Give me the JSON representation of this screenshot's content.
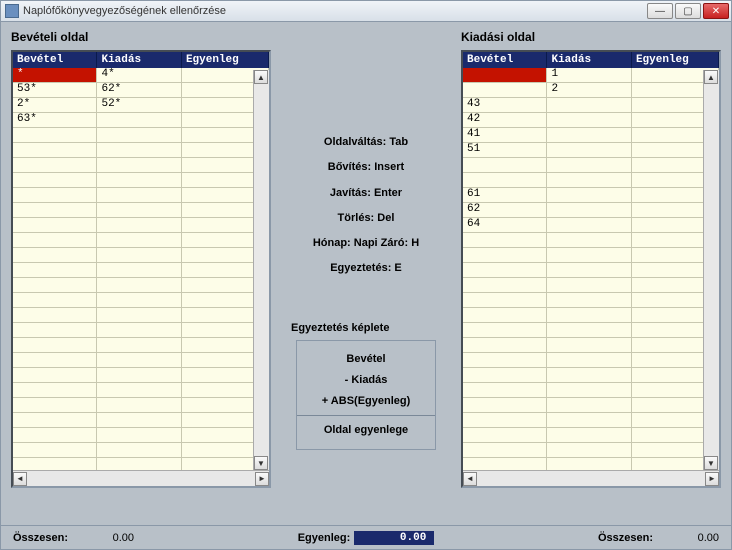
{
  "window": {
    "title": "Naplófőkönyvegyezőségének ellenőrzése"
  },
  "left": {
    "title": "Bevételi oldal",
    "headers": {
      "a": "Bevétel",
      "b": "Kiadás",
      "c": "Egyenleg"
    },
    "rows": [
      {
        "a": "*",
        "b": "4*",
        "c": "",
        "selected": true
      },
      {
        "a": "53*",
        "b": "62*",
        "c": ""
      },
      {
        "a": "2*",
        "b": "52*",
        "c": ""
      },
      {
        "a": "63*",
        "b": "",
        "c": ""
      }
    ],
    "sum_label": "Összesen:",
    "sum_value": "0.00"
  },
  "right": {
    "title": "Kiadási oldal",
    "headers": {
      "a": "Bevétel",
      "b": "Kiadás",
      "c": "Egyenleg"
    },
    "rows": [
      {
        "a": "",
        "b": "1",
        "c": "",
        "selected": true
      },
      {
        "a": "",
        "b": "2",
        "c": ""
      },
      {
        "a": "43",
        "b": "",
        "c": ""
      },
      {
        "a": "42",
        "b": "",
        "c": ""
      },
      {
        "a": "41",
        "b": "",
        "c": ""
      },
      {
        "a": "51",
        "b": "",
        "c": ""
      },
      {
        "a": "",
        "b": "",
        "c": ""
      },
      {
        "a": "",
        "b": "",
        "c": ""
      },
      {
        "a": "61",
        "b": "",
        "c": ""
      },
      {
        "a": "62",
        "b": "",
        "c": ""
      },
      {
        "a": "64",
        "b": "",
        "c": ""
      }
    ],
    "sum_label": "Összesen:",
    "sum_value": "0.00"
  },
  "hints": {
    "page_switch": {
      "label": "Oldalváltás:",
      "value": "Tab"
    },
    "expand": {
      "label": "Bővítés:",
      "value": "Insert"
    },
    "edit": {
      "label": "Javítás:",
      "value": "Enter"
    },
    "delete": {
      "label": "Törlés:",
      "value": "Del"
    },
    "month_close": {
      "label": "Hónap: Napi Záró:",
      "value": "H"
    },
    "reconcile": {
      "label": "Egyeztetés:",
      "value": "E"
    }
  },
  "formula": {
    "title": "Egyeztetés képlete",
    "line1": "Bevétel",
    "line2": "-  Kiadás",
    "line3": "+ ABS(Egyenleg)",
    "line4": "Oldal egyenlege"
  },
  "balance": {
    "label": "Egyenleg:",
    "value": "0.00"
  }
}
